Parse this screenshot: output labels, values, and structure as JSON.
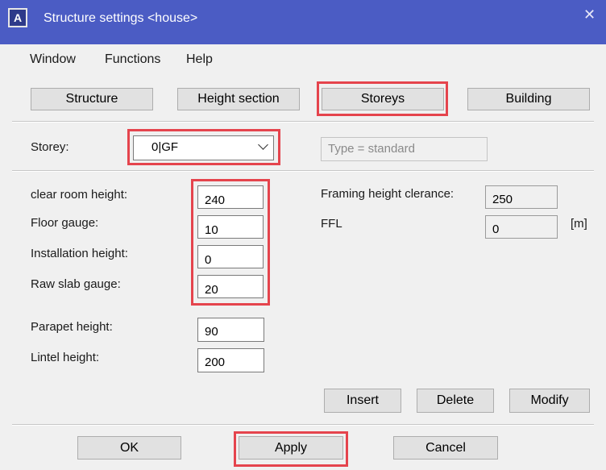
{
  "window": {
    "title": "Structure settings <house>",
    "app_icon": "A",
    "close_glyph": "✕"
  },
  "menu": [
    "Window",
    "Functions",
    "Help"
  ],
  "tabs": {
    "structure": "Structure",
    "height_section": "Height section",
    "storeys": "Storeys",
    "building": "Building"
  },
  "storey": {
    "label": "Storey:",
    "value": "0|GF",
    "type_value": "Type = standard"
  },
  "fields": {
    "clear_room_height": {
      "label": "clear room height:",
      "value": "240"
    },
    "floor_gauge": {
      "label": "Floor gauge:",
      "value": "10"
    },
    "installation_height": {
      "label": "Installation height:",
      "value": "0"
    },
    "raw_slab_gauge": {
      "label": "Raw slab gauge:",
      "value": "20"
    },
    "parapet_height": {
      "label": "Parapet height:",
      "value": "90"
    },
    "lintel_height": {
      "label": "Lintel height:",
      "value": "200"
    },
    "framing_height_clearance": {
      "label": "Framing height clerance:",
      "value": "250"
    },
    "ffl": {
      "label": "FFL",
      "value": "0",
      "unit": "[m]"
    }
  },
  "actions": {
    "insert": "Insert",
    "delete": "Delete",
    "modify": "Modify"
  },
  "footer": {
    "ok": "OK",
    "apply": "Apply",
    "cancel": "Cancel"
  },
  "colors": {
    "title_bar": "#4b5cc4",
    "highlight": "#e5444d"
  }
}
